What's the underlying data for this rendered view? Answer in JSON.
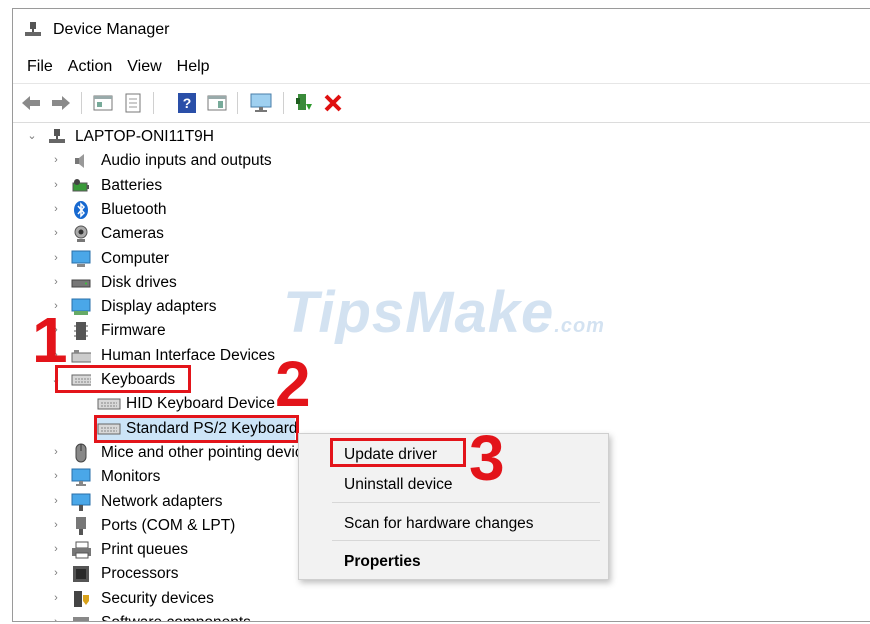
{
  "window": {
    "title": "Device Manager"
  },
  "menu": [
    "File",
    "Action",
    "View",
    "Help"
  ],
  "toolbar": [
    "back-icon",
    "forward-icon",
    "properties-icon",
    "update-icon",
    "help-icon",
    "view-icon",
    "monitor-icon",
    "add-driver-icon",
    "uninstall-icon"
  ],
  "tree": {
    "root": "LAPTOP-ONI11T9H",
    "categories": [
      {
        "label": "Audio inputs and outputs"
      },
      {
        "label": "Batteries"
      },
      {
        "label": "Bluetooth"
      },
      {
        "label": "Cameras"
      },
      {
        "label": "Computer"
      },
      {
        "label": "Disk drives"
      },
      {
        "label": "Display adapters"
      },
      {
        "label": "Firmware"
      },
      {
        "label": "Human Interface Devices"
      },
      {
        "label": "Keyboards"
      },
      {
        "label": "Mice and other pointing devices"
      },
      {
        "label": "Monitors"
      },
      {
        "label": "Network adapters"
      },
      {
        "label": "Ports (COM & LPT)"
      },
      {
        "label": "Print queues"
      },
      {
        "label": "Processors"
      },
      {
        "label": "Security devices"
      },
      {
        "label": "Software components"
      }
    ],
    "keyboard_children": [
      "HID Keyboard Device",
      "Standard PS/2 Keyboard"
    ]
  },
  "context_menu": {
    "items": [
      "Update driver",
      "Uninstall device",
      "Scan for hardware changes",
      "Properties"
    ]
  },
  "annotations": {
    "step1": "1",
    "step2": "2",
    "step3": "3",
    "highlight_color": "#e3141a"
  },
  "watermark": {
    "main": "TipsMake",
    "suffix": ".com"
  }
}
